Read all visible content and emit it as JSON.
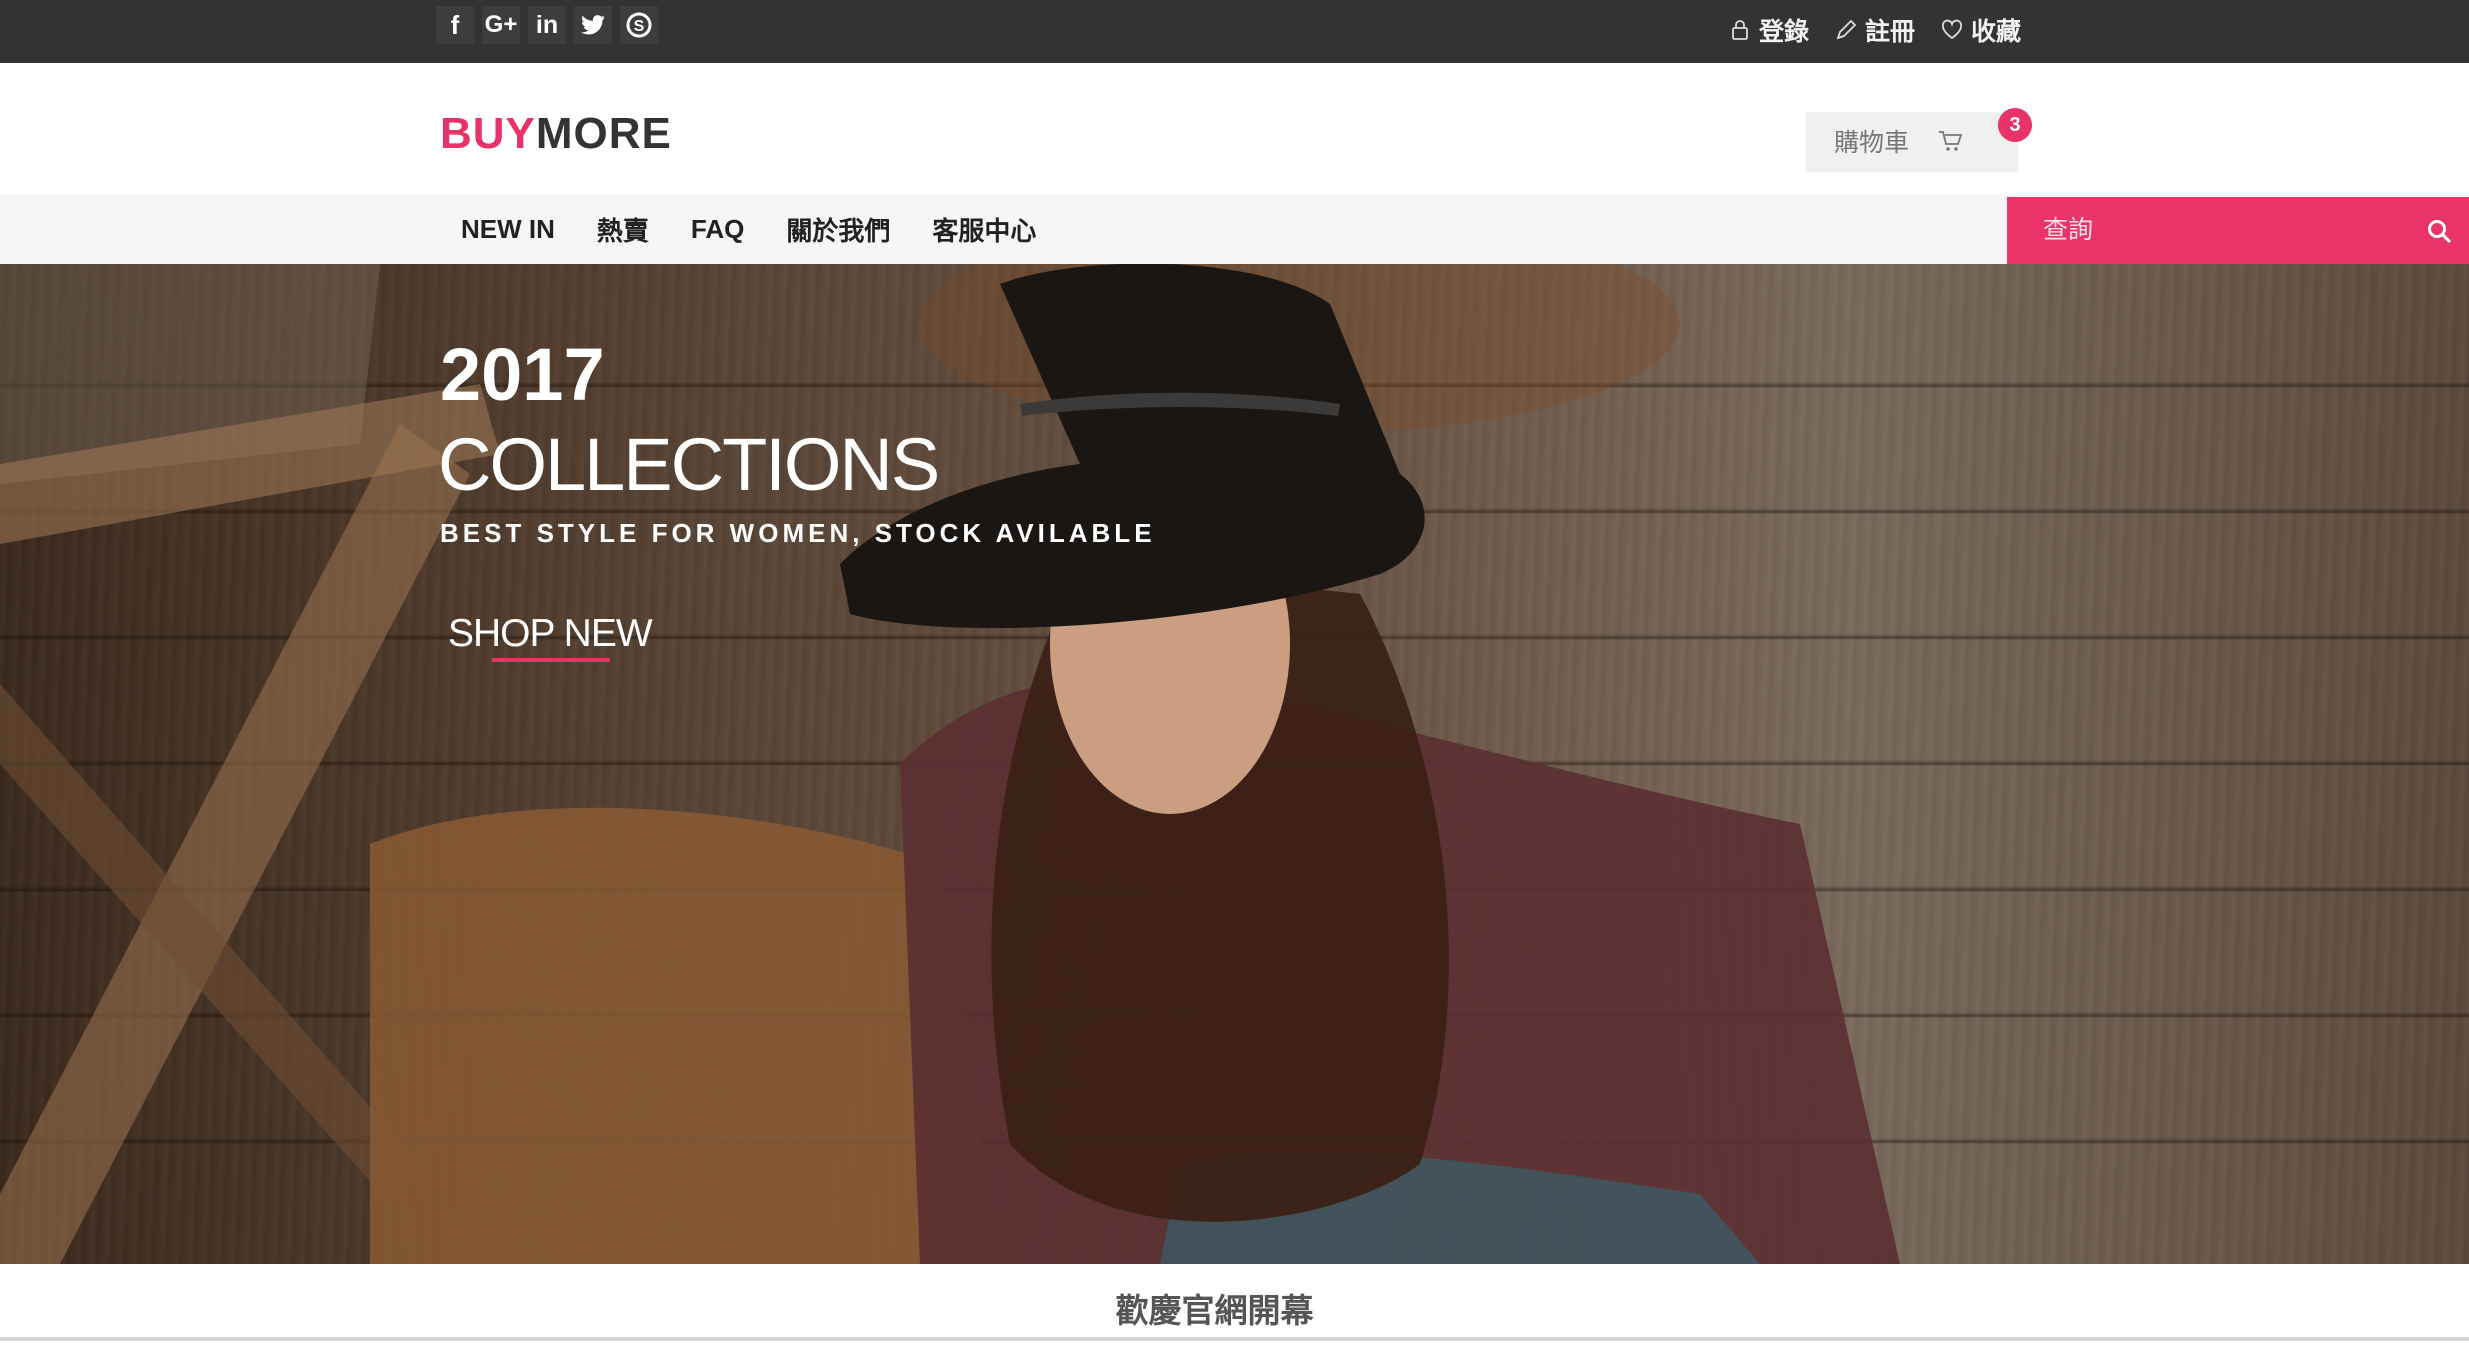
{
  "topbar": {
    "social": [
      {
        "icon": "facebook-icon",
        "glyph": "f"
      },
      {
        "icon": "google-plus-icon",
        "glyph": "G+"
      },
      {
        "icon": "linkedin-icon",
        "glyph": "in"
      },
      {
        "icon": "twitter-icon",
        "glyph": "t"
      },
      {
        "icon": "skype-icon",
        "glyph": "S"
      }
    ],
    "login_label": "登錄",
    "register_label": "註冊",
    "favorites_label": "收藏"
  },
  "header": {
    "logo_part1": "BUY",
    "logo_part2": "MORE",
    "cart_label": "購物車",
    "cart_count": "3"
  },
  "nav": {
    "items": [
      "NEW IN",
      "熱賣",
      "FAQ",
      "關於我們",
      "客服中心"
    ]
  },
  "search": {
    "placeholder": "查詢"
  },
  "hero": {
    "year": "2017",
    "collections": "COLLECTIONS",
    "tagline": "BEST STYLE FOR WOMEN, STOCK AVILABLE",
    "shop_label": "SHOP NEW"
  },
  "welcome": {
    "title": "歡慶官網開幕"
  },
  "colors": {
    "accent": "#e8336a",
    "topbar": "#333333",
    "navbar": "#f6f6f6"
  }
}
